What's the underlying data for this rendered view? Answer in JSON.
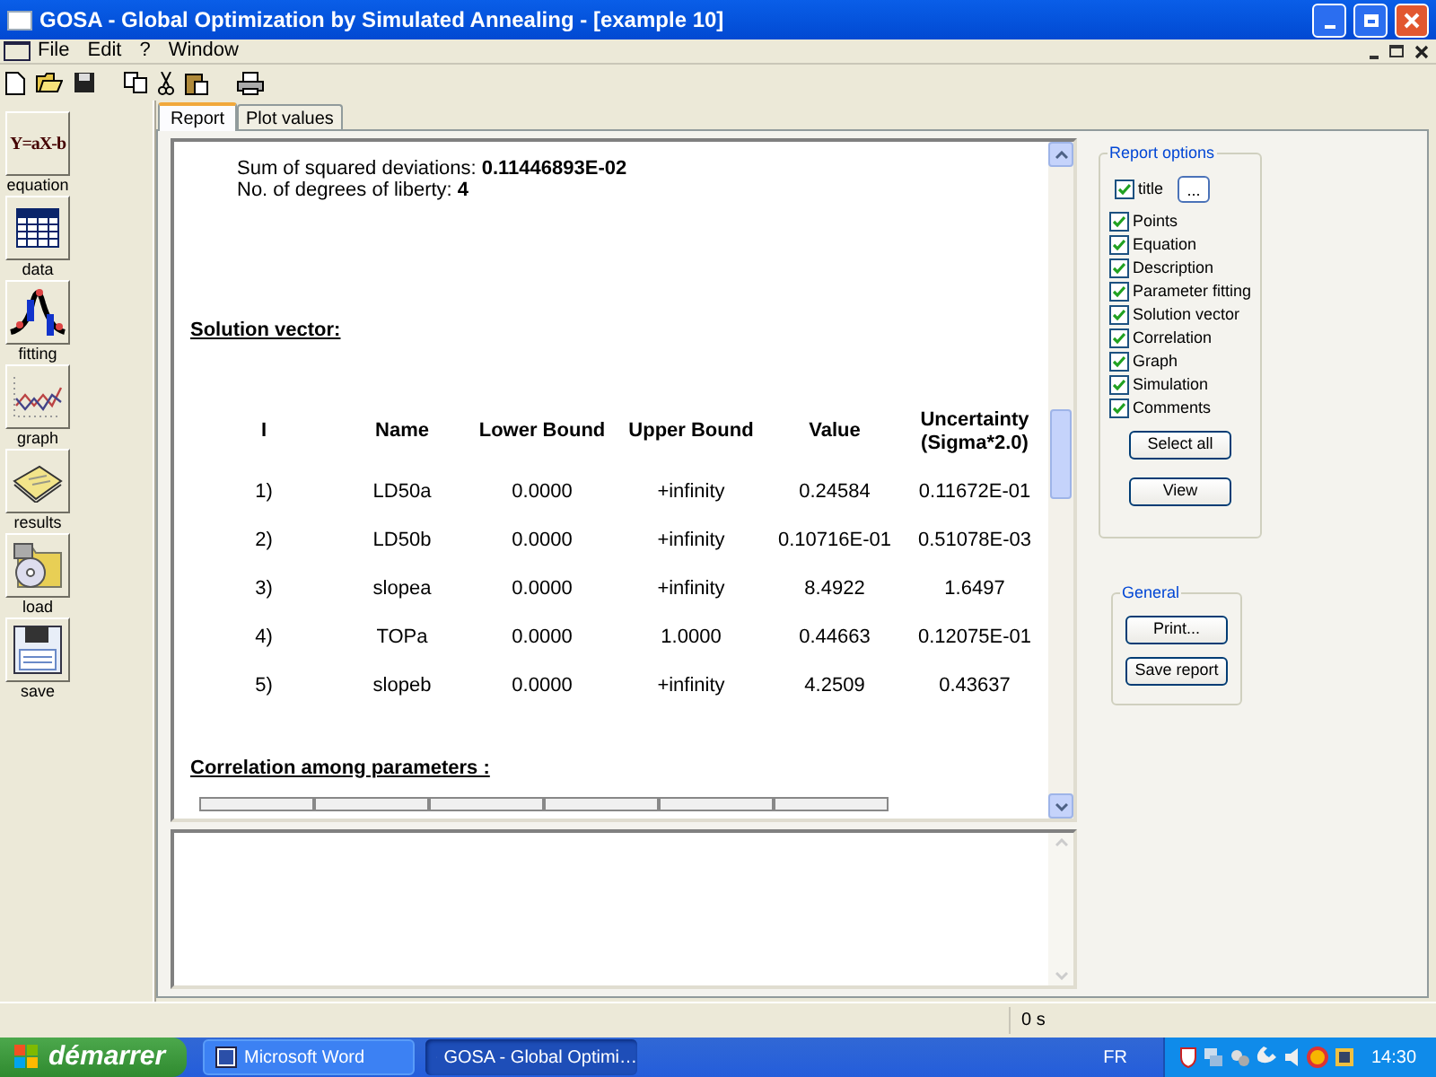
{
  "window": {
    "title": "GOSA - Global Optimization by Simulated Annealing - [example 10]"
  },
  "menu": [
    "File",
    "Edit",
    "?",
    "Window"
  ],
  "sidebar": [
    {
      "kind": "equation",
      "label": "equation",
      "icon_text": "Y=aX-b"
    },
    {
      "kind": "data",
      "label": "data"
    },
    {
      "kind": "fitting",
      "label": "fitting"
    },
    {
      "kind": "graph",
      "label": "graph"
    },
    {
      "kind": "results",
      "label": "results"
    },
    {
      "kind": "load",
      "label": "load"
    },
    {
      "kind": "save",
      "label": "save"
    }
  ],
  "tabs": [
    {
      "label": "Report",
      "selected": true
    },
    {
      "label": "Plot values",
      "selected": false
    }
  ],
  "report": {
    "summary": [
      "Sum of squared deviations: **0.11446893E-02**",
      "No. of degrees of liberty: **4**"
    ],
    "solution_heading": "Solution vector:",
    "columns": [
      "I",
      "Name",
      "Lower Bound",
      "Upper Bound",
      "Value",
      "Uncertainty (Sigma*2.0)"
    ],
    "rows": [
      [
        "1)",
        "LD50a",
        "0.0000",
        "+infinity",
        "0.24584",
        "0.11672E-01"
      ],
      [
        "2)",
        "LD50b",
        "0.0000",
        "+infinity",
        "0.10716E-01",
        "0.51078E-03"
      ],
      [
        "3)",
        "slopea",
        "0.0000",
        "+infinity",
        "8.4922",
        "1.6497"
      ],
      [
        "4)",
        "TOPa",
        "0.0000",
        "1.0000",
        "0.44663",
        "0.12075E-01"
      ],
      [
        "5)",
        "slopeb",
        "0.0000",
        "+infinity",
        "4.2509",
        "0.43637"
      ]
    ],
    "correlation_heading": "Correlation among parameters :"
  },
  "report_options": {
    "title": "Report options",
    "title_checkbox": {
      "label": "title",
      "checked": true
    },
    "title_button": "...",
    "items": [
      {
        "label": "Points",
        "checked": true
      },
      {
        "label": "Equation",
        "checked": true
      },
      {
        "label": "Description",
        "checked": true
      },
      {
        "label": "Parameter fitting",
        "checked": true
      },
      {
        "label": "Solution vector",
        "checked": true
      },
      {
        "label": "Correlation",
        "checked": true
      },
      {
        "label": "Graph",
        "checked": true
      },
      {
        "label": "Simulation",
        "checked": true
      },
      {
        "label": "Comments",
        "checked": true
      }
    ],
    "buttons": [
      "Select all",
      "View"
    ]
  },
  "general": {
    "title": "General",
    "buttons": [
      "Print...",
      "Save report"
    ]
  },
  "status_bar": {
    "elapsed": "0 s"
  },
  "taskbar": {
    "start": "démarrer",
    "tasks": [
      {
        "label": "Microsoft Word",
        "selected": false
      },
      {
        "label": "GOSA - Global Optimi…",
        "selected": true
      }
    ],
    "language": "FR",
    "clock": "14:30"
  }
}
